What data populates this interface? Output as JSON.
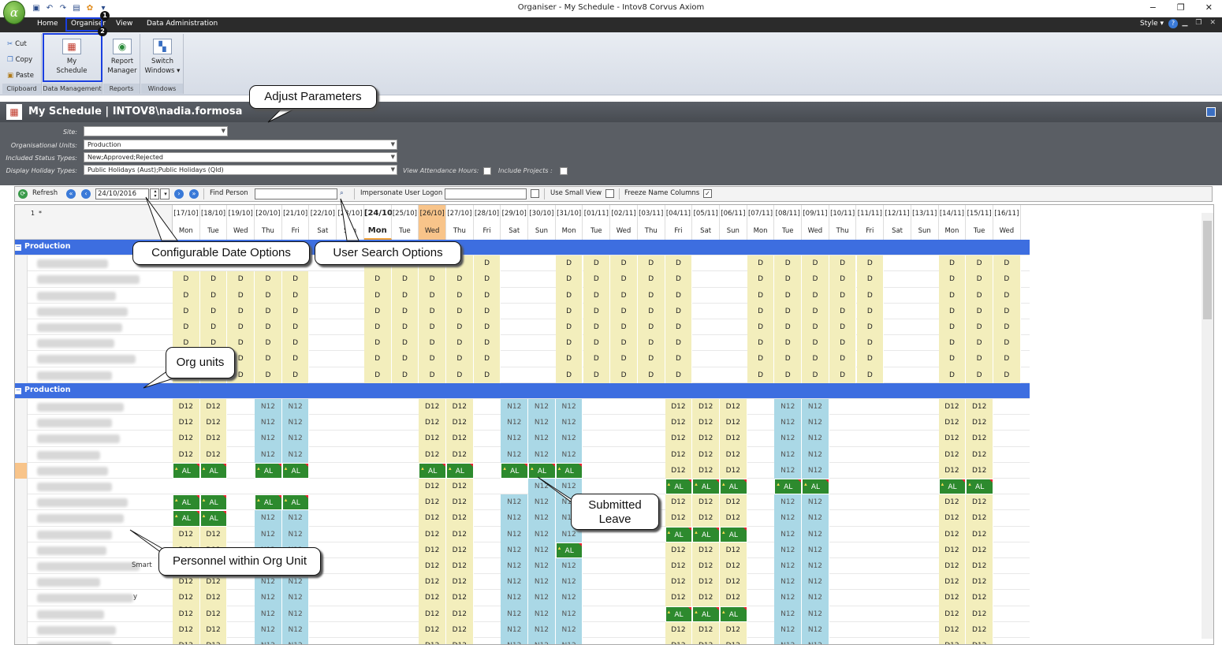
{
  "window": {
    "title": "Organiser - My Schedule - Intov8 Corvus Axiom",
    "logo_char": "α",
    "controls": [
      "−",
      "❐",
      "✕"
    ]
  },
  "tabs": {
    "home": "Home",
    "organiser": "Organiser",
    "view": "View",
    "data_admin": "Data Administration",
    "style": "Style",
    "help": "?"
  },
  "ribbon": {
    "clipboard": {
      "cut": "Cut",
      "copy": "Copy",
      "paste": "Paste",
      "label": "Clipboard"
    },
    "data_management": {
      "my_schedule_l1": "My",
      "my_schedule_l2": "Schedule",
      "label": "Data Management"
    },
    "reports": {
      "report_l1": "Report",
      "report_l2": "Manager",
      "label": "Reports"
    },
    "windows": {
      "switch_l1": "Switch",
      "switch_l2": "Windows",
      "label": "Windows"
    }
  },
  "page": {
    "title": "My Schedule | INTOV8\\nadia.formosa"
  },
  "params": {
    "site_label": "Site:",
    "org_units_label": "Organisational Units:",
    "org_units_value": "Production",
    "status_label": "Included Status Types:",
    "status_value": "New;Approved;Rejected",
    "holiday_label": "Display Holiday Types:",
    "holiday_value": "Public Holidays (Aust);Public Holidays (Qld)",
    "view_attendance": "View Attendance Hours:",
    "include_projects": "Include Projects :"
  },
  "toolbar": {
    "refresh": "Refresh",
    "date": "24/10/2016",
    "find_person": "Find Person",
    "impersonate": "Impersonate User Logon",
    "small_view": "Use Small View",
    "freeze": "Freeze Name Columns"
  },
  "grid": {
    "corner_1": "1",
    "corner_2": "*",
    "dates": [
      "[17/10]",
      "[18/10]",
      "[19/10]",
      "[20/10]",
      "[21/10]",
      "[22/10]",
      "[23/10]",
      "[24/10]",
      "[25/10]",
      "[26/10]",
      "[27/10]",
      "[28/10]",
      "[29/10]",
      "[30/10]",
      "[31/10]",
      "[01/11]",
      "[02/11]",
      "[03/11]",
      "[04/11]",
      "[05/11]",
      "[06/11]",
      "[07/11]",
      "[08/11]",
      "[09/11]",
      "[10/11]",
      "[11/11]",
      "[12/11]",
      "[13/11]",
      "[14/11]",
      "[15/11]",
      "[16/11]"
    ],
    "days": [
      "Mon",
      "Tue",
      "Wed",
      "Thu",
      "Fri",
      "Sat",
      "Sun",
      "Mon",
      "Tue",
      "Wed",
      "Thu",
      "Fri",
      "Sat",
      "Sun",
      "Mon",
      "Tue",
      "Wed",
      "Thu",
      "Fri",
      "Sat",
      "Sun",
      "Mon",
      "Tue",
      "Wed",
      "Thu",
      "Fri",
      "Sat",
      "Sun",
      "Mon",
      "Tue",
      "Wed"
    ],
    "groups": [
      {
        "label": "Production"
      },
      {
        "label": "Production"
      }
    ],
    "visible_names": [
      "y",
      "Smart"
    ]
  },
  "callouts": {
    "adjust": "Adjust Parameters",
    "date_opts": "Configurable Date Options",
    "user_search": "User Search Options",
    "org_units": "Org units",
    "submitted_1": "Submitted",
    "submitted_2": "Leave",
    "personnel": "Personnel within Org Unit"
  },
  "badges": {
    "one": "1",
    "two": "2"
  }
}
